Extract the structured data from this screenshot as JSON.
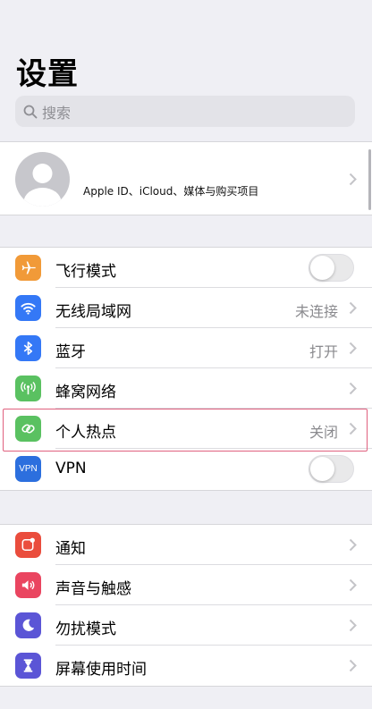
{
  "page": {
    "title": "设置"
  },
  "search": {
    "placeholder": "搜索"
  },
  "profile": {
    "label": "Apple ID、iCloud、媒体与购买项目"
  },
  "groups": [
    {
      "rows": [
        {
          "label": "飞行模式",
          "icon": "airplane-icon",
          "color": "#f19a38",
          "accessory": "toggle",
          "toggle_on": false
        },
        {
          "label": "无线局域网",
          "icon": "wifi-icon",
          "color": "#3478f6",
          "value": "未连接",
          "accessory": "chevron"
        },
        {
          "label": "蓝牙",
          "icon": "bluetooth-icon",
          "color": "#3478f6",
          "value": "打开",
          "accessory": "chevron"
        },
        {
          "label": "蜂窝网络",
          "icon": "cellular-icon",
          "color": "#5ac161",
          "accessory": "chevron"
        },
        {
          "label": "个人热点",
          "icon": "hotspot-icon",
          "color": "#5ac161",
          "value": "关闭",
          "accessory": "chevron",
          "highlighted": true
        },
        {
          "label": "VPN",
          "icon": "vpn-icon",
          "icon_text": "VPN",
          "color": "#2c6fde",
          "accessory": "toggle",
          "toggle_on": false
        }
      ]
    },
    {
      "rows": [
        {
          "label": "通知",
          "icon": "notifications-icon",
          "color": "#ea4d3d",
          "accessory": "chevron"
        },
        {
          "label": "声音与触感",
          "icon": "sound-icon",
          "color": "#ea4560",
          "accessory": "chevron"
        },
        {
          "label": "勿扰模式",
          "icon": "moon-icon",
          "color": "#5b55d6",
          "accessory": "chevron"
        },
        {
          "label": "屏幕使用时间",
          "icon": "hourglass-icon",
          "color": "#5b55d6",
          "accessory": "chevron"
        }
      ]
    }
  ],
  "colors": {
    "highlight_border": "#e0607e",
    "toggle_off": "#e9e9ea"
  }
}
